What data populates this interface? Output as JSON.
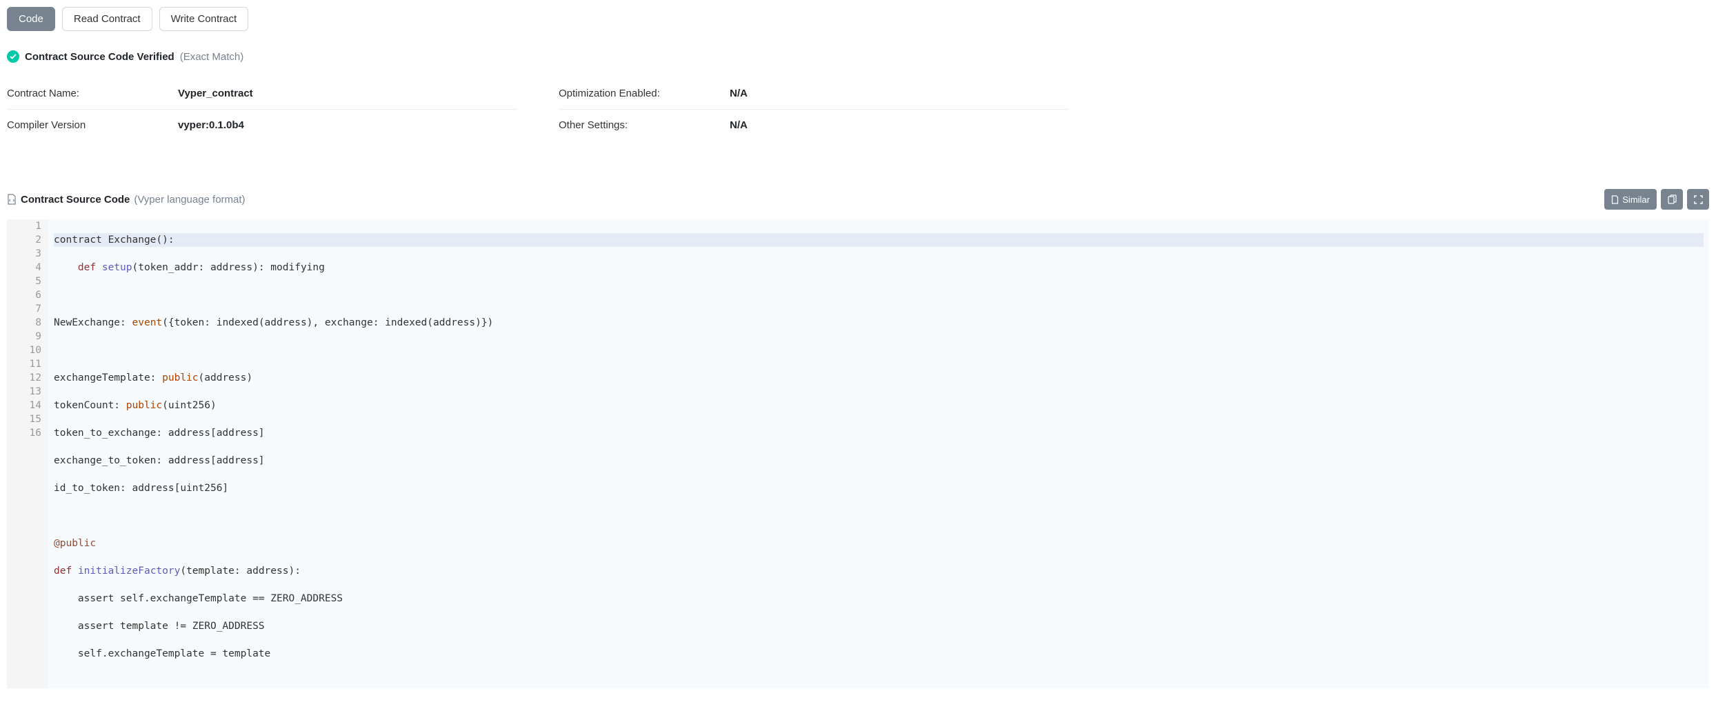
{
  "tabs": {
    "code": "Code",
    "read": "Read Contract",
    "write": "Write Contract"
  },
  "verified": {
    "text": "Contract Source Code Verified",
    "match": "(Exact Match)"
  },
  "details": {
    "contract_name_label": "Contract Name:",
    "contract_name_value": "Vyper_contract",
    "compiler_version_label": "Compiler Version",
    "compiler_version_value": "vyper:0.1.0b4",
    "optimization_label": "Optimization Enabled:",
    "optimization_value": "N/A",
    "other_settings_label": "Other Settings:",
    "other_settings_value": "N/A"
  },
  "source_header": {
    "title": "Contract Source Code",
    "subtitle": "(Vyper language format)",
    "similar_label": "Similar"
  },
  "code": {
    "total_lines": 16,
    "l1_a": "contract Exchange():",
    "l2_a": "    ",
    "l2_b": "def",
    "l2_c": " ",
    "l2_d": "setup",
    "l2_e": "(token_addr: address): modifying",
    "l3": "",
    "l4_a": "NewExchange: ",
    "l4_b": "event",
    "l4_c": "({token: indexed(address), exchange: indexed(address)})",
    "l5": "",
    "l6_a": "exchangeTemplate: ",
    "l6_b": "public",
    "l6_c": "(address)",
    "l7_a": "tokenCount: ",
    "l7_b": "public",
    "l7_c": "(uint256)",
    "l8_a": "token_to_exchange: address[address]",
    "l9_a": "exchange_to_token: address[address]",
    "l10_a": "id_to_token: address[uint256]",
    "l11": "",
    "l12_a": "@public",
    "l13_a": "def",
    "l13_b": " ",
    "l13_c": "initializeFactory",
    "l13_d": "(template: address):",
    "l14_a": "    assert self.exchangeTemplate == ZERO_ADDRESS",
    "l15_a": "    assert template != ZERO_ADDRESS",
    "l16_a": "    self.exchangeTemplate = template"
  }
}
